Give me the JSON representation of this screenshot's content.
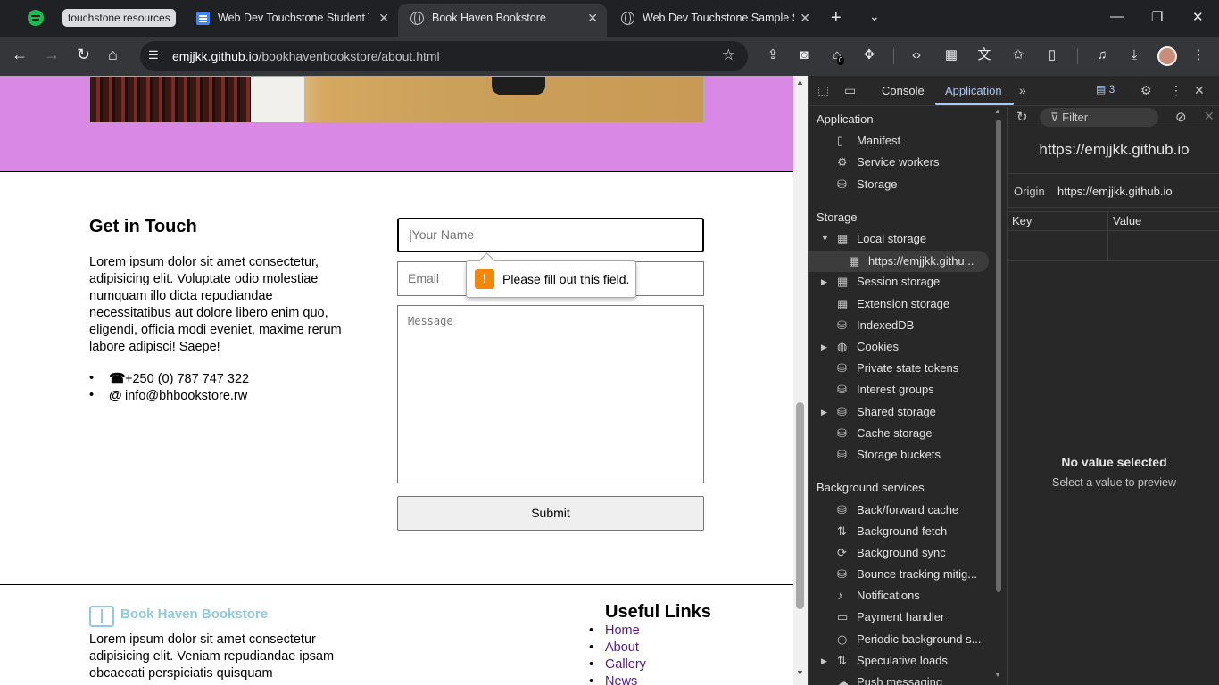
{
  "browser": {
    "tab_group_label": "touchstone resources",
    "tabs": [
      {
        "title": "Web Dev Touchstone Student Te",
        "icon": "docs-icon",
        "active": false
      },
      {
        "title": "Book Haven Bookstore",
        "icon": "globe-icon",
        "active": true
      },
      {
        "title": "Web Dev Touchstone Sample Su",
        "icon": "globe-icon",
        "active": false
      }
    ],
    "url_host": "emjjkk.github.io",
    "url_path": "/bookhavenbookstore/about.html",
    "extension_badge": "0"
  },
  "page": {
    "contact": {
      "title": "Get in Touch",
      "text": "Lorem ipsum dolor sit amet consectetur, adipisicing elit. Voluptate odio molestiae numquam illo dicta repudiandae necessitatibus aut dolore libero enim quo, eligendi, officia modi eveniet, maxime rerum labore adipisci! Saepe!",
      "phone": "+250 (0) 787 747 322",
      "email": "info@bhbookstore.rw"
    },
    "form": {
      "name_placeholder": "Your Name",
      "email_placeholder": "Email",
      "message_placeholder": "Message",
      "submit_label": "Submit",
      "validation_message": "Please fill out this field."
    },
    "footer": {
      "brand": "Book Haven Bookstore",
      "text": "Lorem ipsum dolor sit amet consectetur adipisicing elit. Veniam repudiandae ipsam obcaecati perspiciatis quisquam",
      "links_title": "Useful Links",
      "links": [
        "Home",
        "About",
        "Gallery",
        "News"
      ]
    }
  },
  "devtools": {
    "tabs": [
      "Console",
      "Application"
    ],
    "active_tab": "Application",
    "issues_count": "3",
    "sections": {
      "application": {
        "title": "Application",
        "items": [
          "Manifest",
          "Service workers",
          "Storage"
        ]
      },
      "storage": {
        "title": "Storage",
        "items": [
          "Local storage",
          "https://emjjkk.githu...",
          "Session storage",
          "Extension storage",
          "IndexedDB",
          "Cookies",
          "Private state tokens",
          "Interest groups",
          "Shared storage",
          "Cache storage",
          "Storage buckets"
        ]
      },
      "background": {
        "title": "Background services",
        "items": [
          "Back/forward cache",
          "Background fetch",
          "Background sync",
          "Bounce tracking mitig...",
          "Notifications",
          "Payment handler",
          "Periodic background s...",
          "Speculative loads",
          "Push messaging"
        ]
      }
    },
    "panel": {
      "filter_placeholder": "Filter",
      "origin_header": "https://emjjkk.github.io",
      "origin_label": "Origin",
      "origin_value": "https://emjjkk.github.io",
      "key_col": "Key",
      "value_col": "Value",
      "empty_title": "No value selected",
      "empty_sub": "Select a value to preview"
    }
  },
  "colors": {
    "hero_bg": "#d988e6",
    "brand_color": "#8ecae6",
    "link_color": "#551a8b",
    "warning_orange": "#f5860b",
    "devtools_accent": "#a8c7fa"
  }
}
